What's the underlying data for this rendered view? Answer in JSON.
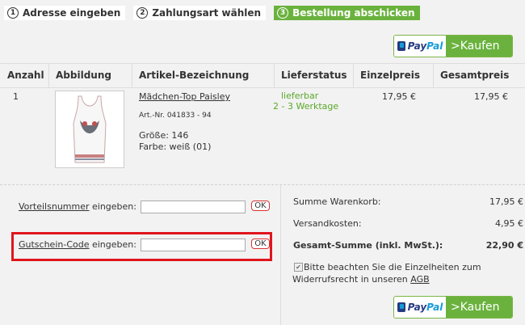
{
  "steps": [
    {
      "num": "1",
      "label": "Adresse eingeben"
    },
    {
      "num": "2",
      "label": "Zahlungsart wählen"
    },
    {
      "num": "3",
      "label": "Bestellung abschicken"
    }
  ],
  "paypal": {
    "brand_a": "Pay",
    "brand_b": "Pal",
    "buy_label_top": ">Kaufen",
    "buy_label_bottom": ">Kaufen"
  },
  "table": {
    "headers": [
      "Anzahl",
      "Abbildung",
      "Artikel-Bezeichnung",
      "Lieferstatus",
      "Einzelpreis",
      "Gesamtpreis"
    ],
    "row": {
      "qty": "1",
      "name": "Mädchen-Top Paisley",
      "art_nr": "Art.-Nr. 041833 - 94",
      "size": "Größe: 146",
      "color": "Farbe: weiß (01)",
      "status": "lieferbar",
      "delivery": "2 - 3 Werktage",
      "unit_price": "17,95 €",
      "total_price": "17,95 €"
    }
  },
  "form": {
    "vorteil_link": "Vorteilsnummer",
    "vorteil_rest": " eingeben:",
    "gutschein_link": "Gutschein-Code",
    "gutschein_rest": " eingeben:",
    "ok_label": "OK"
  },
  "summary": {
    "warenkorb_label": "Summe Warenkorb:",
    "warenkorb_value": "17,95 €",
    "versand_label": "Versandkosten:",
    "versand_value": "4,95 €",
    "gesamt_label": "Gesamt-Summe (inkl. MwSt.):",
    "gesamt_value": "22,90 €",
    "note_text": "Bitte beachten Sie die Einzelheiten zum Widerrufsrecht in unseren ",
    "agb_link": "AGB"
  },
  "colors": {
    "green": "#6ab23d",
    "highlight": "#e0151c"
  }
}
